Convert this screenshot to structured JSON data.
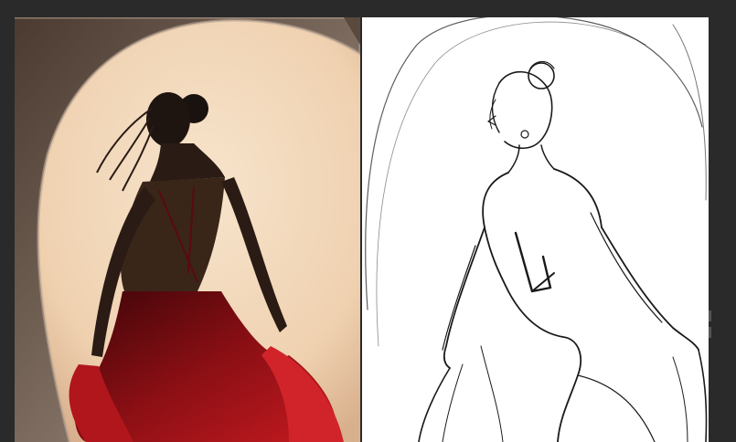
{
  "workspace": {
    "background": "#2a2a2a"
  },
  "photo_panel": {
    "subject": "woman-in-red-backless-dress",
    "colors": {
      "sky": "#f3dcc0",
      "cave": "#6e5e52",
      "dress": "#8a0f14",
      "skin": "#1e1410"
    }
  },
  "sketch_panel": {
    "subject": "line-sketch-of-woman",
    "colors": {
      "paper": "#ffffff",
      "ink": "#1a1a1a"
    }
  }
}
